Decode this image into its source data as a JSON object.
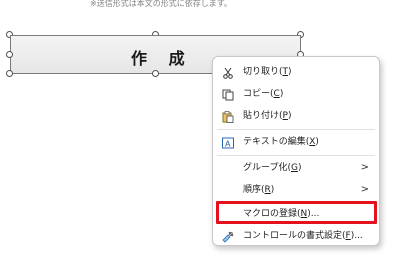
{
  "note": "※送信形式は本文の形式に依存します。",
  "form_button": {
    "label": "作 成"
  },
  "context_menu": {
    "items": [
      {
        "icon": "scissors-icon",
        "label": "切り取り(",
        "accel": "T",
        "suffix": ")"
      },
      {
        "icon": "copy-icon",
        "label": "コピー(",
        "accel": "C",
        "suffix": ")"
      },
      {
        "icon": "paste-icon",
        "label": "貼り付け(",
        "accel": "P",
        "suffix": ")"
      },
      {
        "icon": "text-edit-icon",
        "label": "テキストの編集(",
        "accel": "X",
        "suffix": ")"
      },
      {
        "icon": "",
        "label": "グループ化(",
        "accel": "G",
        "suffix": ")",
        "submenu_arrow": ">"
      },
      {
        "icon": "",
        "label": "順序(",
        "accel": "R",
        "suffix": ")",
        "submenu_arrow": ">"
      },
      {
        "icon": "",
        "label": "マクロの登録(",
        "accel": "N",
        "suffix": ")..."
      },
      {
        "icon": "format-control-icon",
        "label": "コントロールの書式設定(",
        "accel": "F",
        "suffix": ")..."
      }
    ]
  },
  "highlight": {
    "color": "#e3121d",
    "target": "マクロの登録(N)..."
  }
}
